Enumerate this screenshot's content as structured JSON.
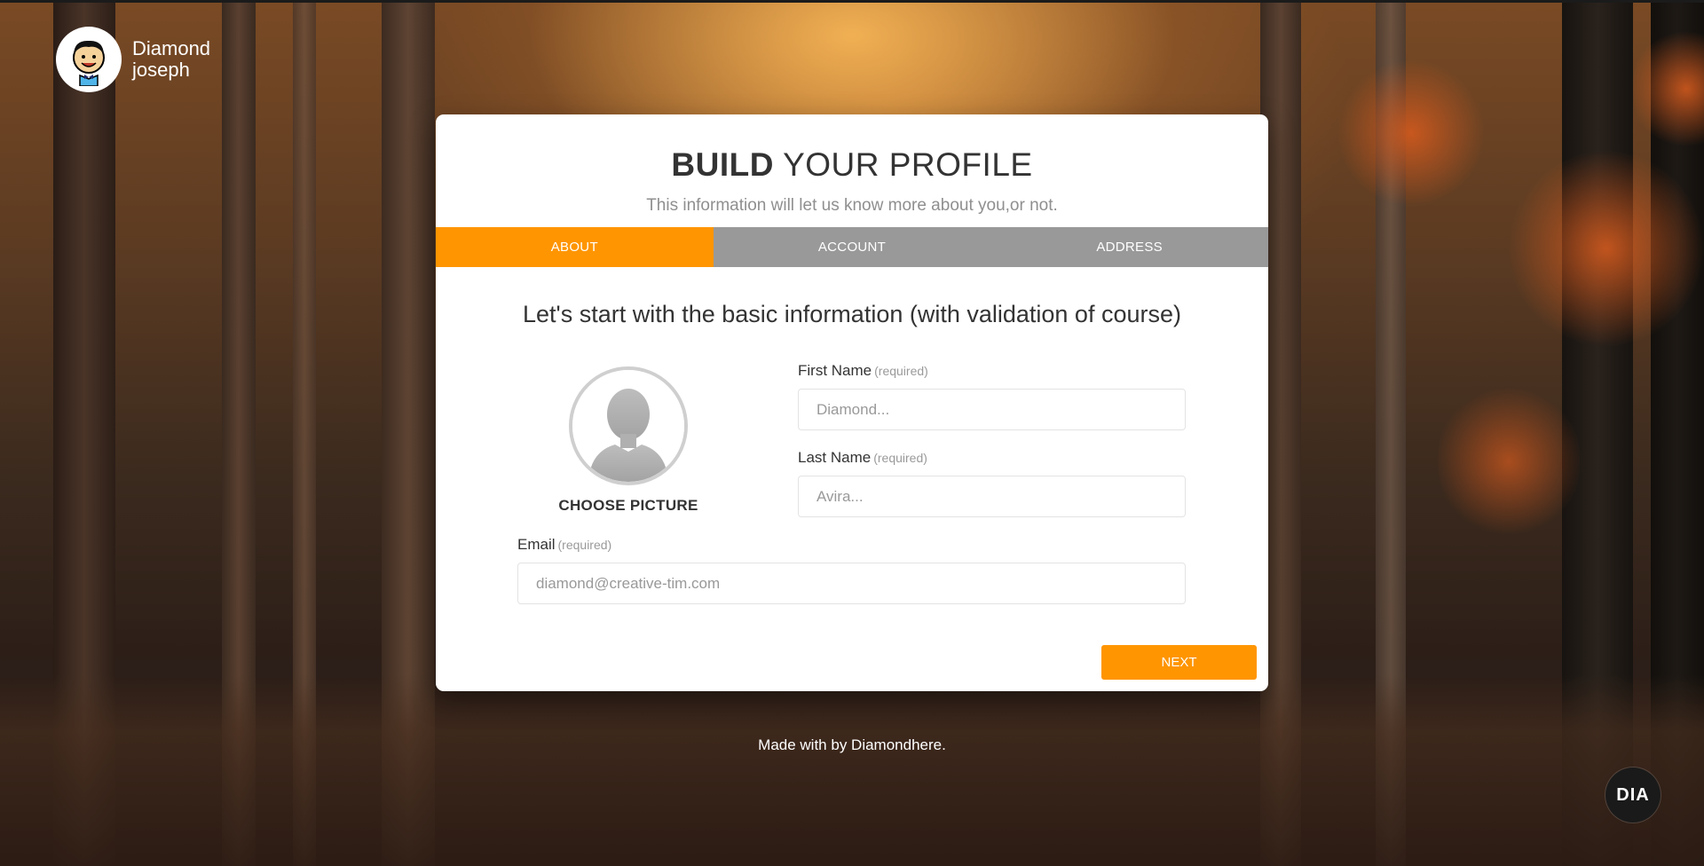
{
  "user": {
    "first_name": "Diamond",
    "last_name": "joseph"
  },
  "wizard": {
    "title_bold": "BUILD",
    "title_rest": "YOUR PROFILE",
    "subtitle": "This information will let us know more about you,or not.",
    "tabs": [
      {
        "label": "About",
        "active": true
      },
      {
        "label": "Account",
        "active": false
      },
      {
        "label": "Address",
        "active": false
      }
    ],
    "section_heading": "Let's start with the basic information (with validation of course)",
    "choose_picture": "CHOOSE PICTURE",
    "fields": {
      "first_name": {
        "label": "First Name",
        "note": "(required)",
        "placeholder": "Diamond...",
        "value": ""
      },
      "last_name": {
        "label": "Last Name",
        "note": "(required)",
        "placeholder": "Avira...",
        "value": ""
      },
      "email": {
        "label": "Email",
        "note": "(required)",
        "placeholder": "diamond@creative-tim.com",
        "value": ""
      }
    },
    "next_label": "Next"
  },
  "footer": {
    "text": "Made with by Diamondhere."
  },
  "badge": {
    "text": "DIA"
  },
  "colors": {
    "accent": "#ff9500",
    "tab_inactive": "#999999"
  }
}
